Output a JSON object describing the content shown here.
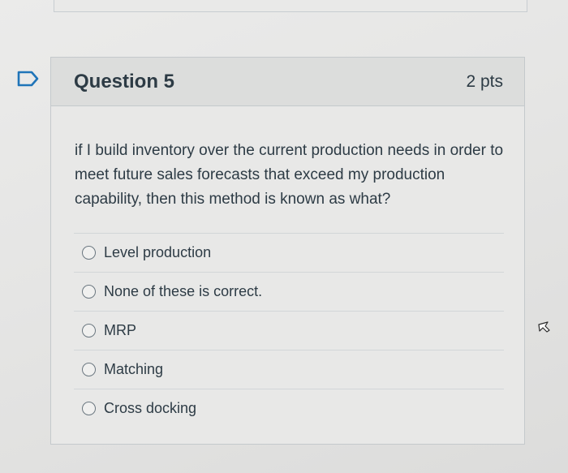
{
  "question": {
    "title": "Question 5",
    "points": "2 pts",
    "text": "if I build inventory over the current production needs in order to meet future sales forecasts that exceed my production capability, then this method is known as what?",
    "answers": [
      {
        "label": "Level production",
        "selected": false
      },
      {
        "label": "None of these is correct.",
        "selected": false
      },
      {
        "label": "MRP",
        "selected": false
      },
      {
        "label": "Matching",
        "selected": false
      },
      {
        "label": "Cross docking",
        "selected": false
      }
    ]
  },
  "icons": {
    "flag": "flag-question-icon",
    "cursor": "mouse-pointer-icon"
  },
  "colors": {
    "text": "#2d3b45",
    "flag_outline": "#1f74b8",
    "header_bg": "#dcdddc",
    "border": "#c4c9cc"
  }
}
